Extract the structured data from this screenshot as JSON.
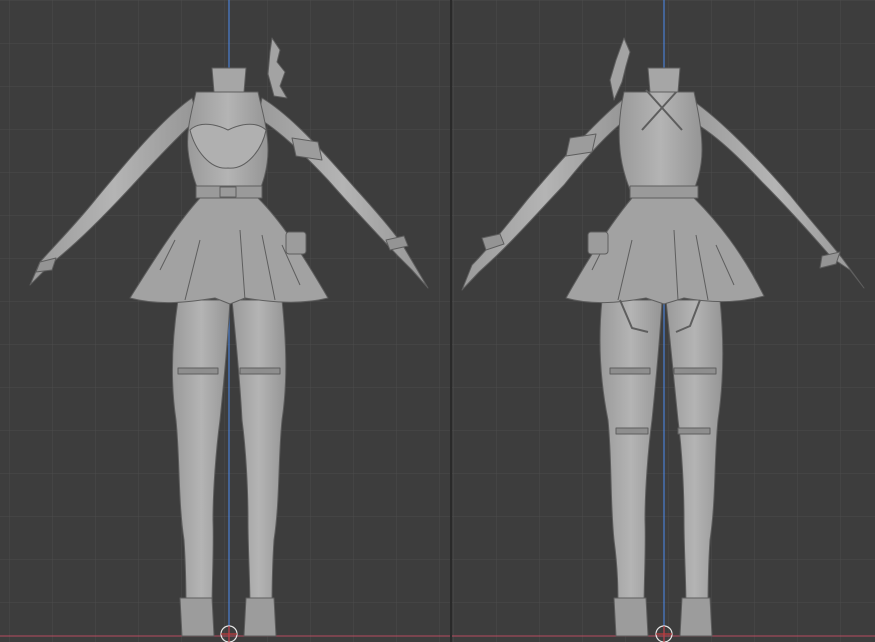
{
  "texts": [],
  "views": [
    {
      "name": "front-view"
    },
    {
      "name": "back-view"
    }
  ],
  "colors": {
    "background": "#3d3d3d",
    "grid_line": "#4c4c4c",
    "axis_y": "#4a7fd1",
    "axis_x": "#a04a5a",
    "model_fill": "#a9a9a9",
    "model_shadow": "#7e7e7e",
    "model_outline": "#5e5e5e"
  }
}
